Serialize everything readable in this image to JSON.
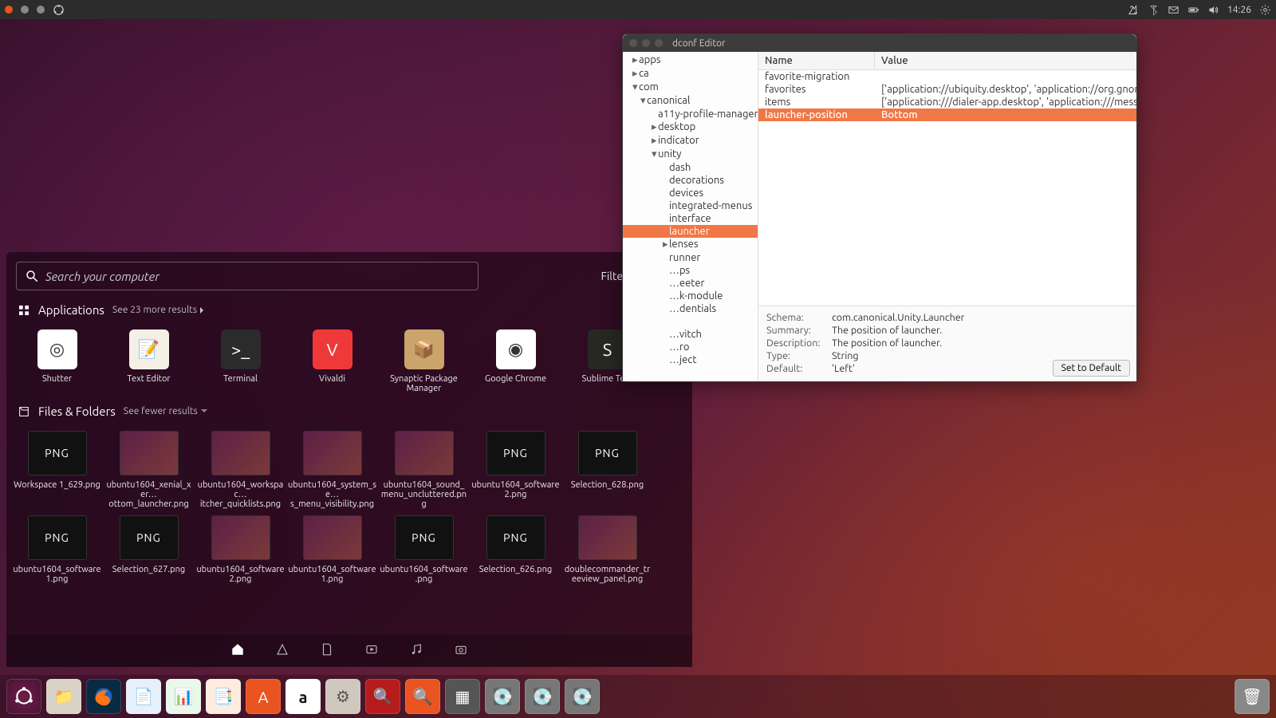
{
  "topbar": {
    "time": "14:26"
  },
  "dash": {
    "search_placeholder": "Search your computer",
    "filter_label": "Filter results",
    "apps_header": "Applications",
    "apps_more": "See 23 more results",
    "apps": [
      {
        "label": "Shutter",
        "bg": "#fff"
      },
      {
        "label": "Text Editor",
        "bg": "#f5f0e6"
      },
      {
        "label": "Terminal",
        "bg": "#2b2b2b"
      },
      {
        "label": "Vivaldi",
        "bg": "#ef3939"
      },
      {
        "label": "Synaptic Package Manager",
        "bg": "#caa46a"
      },
      {
        "label": "Google Chrome",
        "bg": "#fff"
      },
      {
        "label": "Sublime Text",
        "bg": "#272822"
      }
    ],
    "files_header": "Files & Folders",
    "files_more": "See fewer results",
    "files": [
      {
        "label": "Workspace 1_629.png",
        "thumb": "png"
      },
      {
        "label": "ubuntu1604_xenial_xer…ottom_launcher.png",
        "thumb": "sc"
      },
      {
        "label": "ubuntu1604_workspac…itcher_quicklists.png",
        "thumb": "sc"
      },
      {
        "label": "ubuntu1604_system_se…s_menu_visibility.png",
        "thumb": "sc"
      },
      {
        "label": "ubuntu1604_sound_menu_uncluttered.png",
        "thumb": "sc"
      },
      {
        "label": "ubuntu1604_software2.png",
        "thumb": "png"
      },
      {
        "label": "Selection_628.png",
        "thumb": "png"
      },
      {
        "label": "ubuntu1604_software1.png",
        "thumb": "png"
      },
      {
        "label": "Selection_627.png",
        "thumb": "png"
      },
      {
        "label": "ubuntu1604_software2.png",
        "thumb": "sc"
      },
      {
        "label": "ubuntu1604_software1.png",
        "thumb": "sc"
      },
      {
        "label": "ubuntu1604_software.png",
        "thumb": "png"
      },
      {
        "label": "Selection_626.png",
        "thumb": "png"
      },
      {
        "label": "doublecommander_treeview_panel.png",
        "thumb": "sc"
      }
    ]
  },
  "launcher": {
    "items": [
      "ubuntu",
      "files",
      "firefox",
      "writer",
      "calc",
      "impress",
      "software",
      "amazon",
      "settings",
      "viewer",
      "help",
      "workspace",
      "drive1",
      "drive2",
      "drive3"
    ],
    "trash": "trash"
  },
  "dconf": {
    "title": "dconf Editor",
    "tree": [
      {
        "label": "apps",
        "depth": 0,
        "caret": "▸"
      },
      {
        "label": "ca",
        "depth": 0,
        "caret": "▸"
      },
      {
        "label": "com",
        "depth": 0,
        "caret": "▾"
      },
      {
        "label": "canonical",
        "depth": 1,
        "caret": "▾"
      },
      {
        "label": "a11y-profile-manager",
        "depth": 2,
        "caret": ""
      },
      {
        "label": "desktop",
        "depth": 2,
        "caret": "▸"
      },
      {
        "label": "indicator",
        "depth": 2,
        "caret": "▸"
      },
      {
        "label": "unity",
        "depth": 2,
        "caret": "▾"
      },
      {
        "label": "dash",
        "depth": 3,
        "caret": ""
      },
      {
        "label": "decorations",
        "depth": 3,
        "caret": ""
      },
      {
        "label": "devices",
        "depth": 3,
        "caret": ""
      },
      {
        "label": "integrated-menus",
        "depth": 3,
        "caret": ""
      },
      {
        "label": "interface",
        "depth": 3,
        "caret": ""
      },
      {
        "label": "launcher",
        "depth": 3,
        "caret": "",
        "sel": true
      },
      {
        "label": "lenses",
        "depth": 3,
        "caret": "▸"
      },
      {
        "label": "runner",
        "depth": 3,
        "caret": ""
      },
      {
        "label": "…ps",
        "depth": 3,
        "caret": ""
      },
      {
        "label": "…eeter",
        "depth": 3,
        "caret": ""
      },
      {
        "label": "…k-module",
        "depth": 3,
        "caret": ""
      },
      {
        "label": "…dentials",
        "depth": 3,
        "caret": ""
      },
      {
        "label": "",
        "depth": 3,
        "caret": ""
      },
      {
        "label": "…vitch",
        "depth": 3,
        "caret": ""
      },
      {
        "label": "…ro",
        "depth": 3,
        "caret": ""
      },
      {
        "label": "…ject",
        "depth": 3,
        "caret": ""
      }
    ],
    "cols": {
      "c1": "Name",
      "c2": "Value"
    },
    "rows": [
      {
        "name": "favorite-migration",
        "value": ""
      },
      {
        "name": "favorites",
        "value": "['application://ubiquity.desktop', 'application://org.gnome.Na…"
      },
      {
        "name": "items",
        "value": "['application:///dialer-app.desktop', 'application:///messaging…"
      },
      {
        "name": "launcher-position",
        "value": "Bottom",
        "sel": true
      }
    ],
    "detail": {
      "schema_lbl": "Schema:",
      "schema": "com.canonical.Unity.Launcher",
      "summary_lbl": "Summary:",
      "summary": "The position of launcher.",
      "desc_lbl": "Description:",
      "desc": "The position of launcher.",
      "type_lbl": "Type:",
      "type": "String",
      "default_lbl": "Default:",
      "default": "'Left'",
      "reset": "Set to Default"
    }
  }
}
